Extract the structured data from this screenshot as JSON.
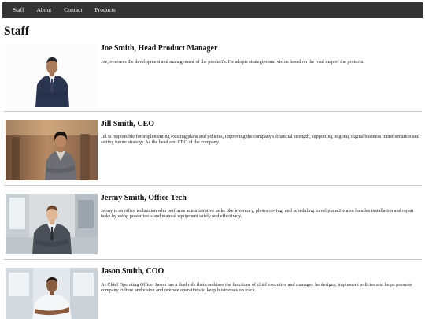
{
  "nav": {
    "items": [
      "Staff",
      "About",
      "Contact",
      "Products"
    ]
  },
  "page": {
    "title": "Staff"
  },
  "staff": [
    {
      "name": "Joe Smith, Head Product Manager",
      "description": "Joe, oversees the development and management of the product's. He adopts strategies and vision based on the road map of the protucts."
    },
    {
      "name": "Jill Smith, CEO",
      "description": "Jill is responsible for implementing existing plans and policies, improving the company's financial strength, supporting ongoing digital business transformation and setting future strategy. As the head and CEO of the company"
    },
    {
      "name": "Jermy Smith, Office Tech",
      "description": "Jermy is an office technician who performs administrative tasks like inventory, photocopying, and scheduling travel plans.He also handles installation and repair tasks by using power tools and manual equipment safely and effectively."
    },
    {
      "name": "Jason Smith, COO",
      "description": "As Chief Operating Officer Jason has a dual role that combines the functions of chief executive and manager. he designs, implement policies and helps promote company culture and vision and oversee operations to keep businesses on track."
    }
  ]
}
